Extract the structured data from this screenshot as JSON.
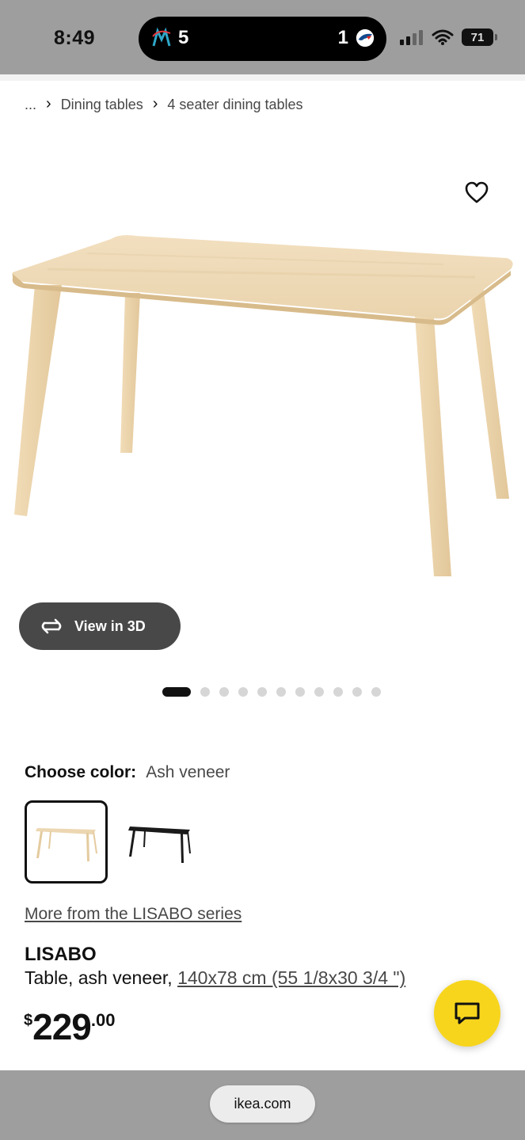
{
  "status_bar": {
    "time": "8:49",
    "score_left": "5",
    "score_right": "1",
    "battery": "71"
  },
  "breadcrumb": {
    "items": [
      "...",
      "Dining tables",
      "4 seater dining tables"
    ]
  },
  "gallery": {
    "view3d_label": "View in 3D",
    "image_count": 11,
    "active_index": 0
  },
  "color_picker": {
    "label": "Choose color:",
    "value": "Ash veneer",
    "swatches": [
      "ash-veneer-table-icon",
      "black-table-icon"
    ]
  },
  "product": {
    "series_link": "More from the LISABO series",
    "name": "LISABO",
    "description": "Table, ash veneer, ",
    "dimensions": "140x78 cm (55 1/8x30 3/4 \")",
    "price_currency": "$",
    "price_integer": "229",
    "price_decimal": ".00"
  },
  "browser": {
    "url": "ikea.com"
  },
  "colors": {
    "accent_yellow": "#f7d51d",
    "button_dark": "#484848"
  }
}
